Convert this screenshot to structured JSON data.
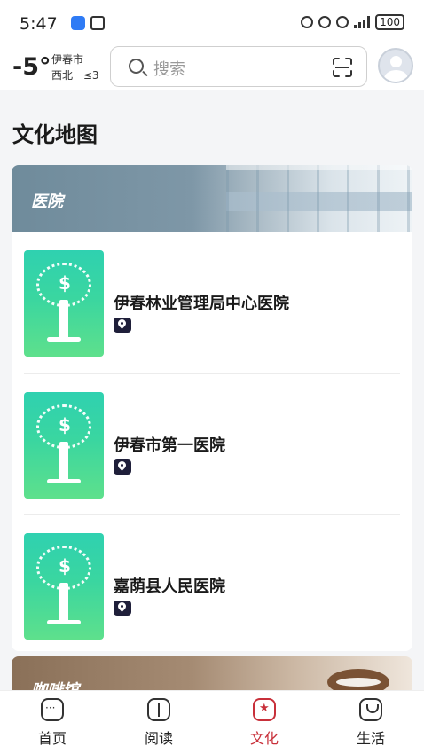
{
  "status_bar": {
    "time": "5:47",
    "battery": "100"
  },
  "header": {
    "temperature": "-5°",
    "city": "伊春市",
    "wind_direction": "西北",
    "wind_level": "≤3",
    "search_placeholder": "搜索"
  },
  "page": {
    "title": "文化地图"
  },
  "sections": [
    {
      "label": "医院",
      "items": [
        {
          "name": "伊春林业管理局中心医院"
        },
        {
          "name": "伊春市第一医院"
        },
        {
          "name": "嘉荫县人民医院"
        }
      ]
    },
    {
      "label": "咖啡馆"
    }
  ],
  "bottom_nav": [
    {
      "label": "首页",
      "icon": "home-icon",
      "active": false
    },
    {
      "label": "阅读",
      "icon": "book-icon",
      "active": false
    },
    {
      "label": "文化",
      "icon": "culture-star-icon",
      "active": true
    },
    {
      "label": "生活",
      "icon": "life-bag-icon",
      "active": false
    }
  ],
  "colors": {
    "accent": "#c8303a",
    "thumb_gradient_top": "#2fd1b0",
    "thumb_gradient_bottom": "#5ee08c"
  }
}
